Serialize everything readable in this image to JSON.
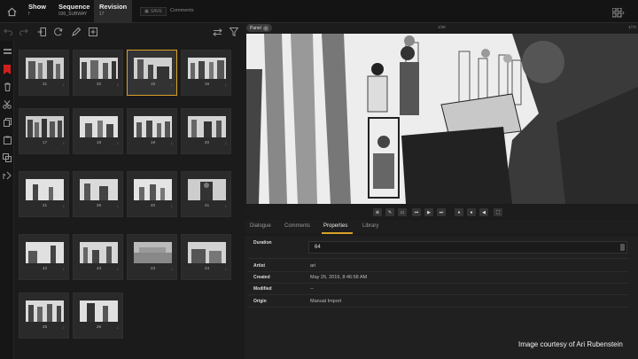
{
  "topbar": {
    "show_title": "Show",
    "show_value": "f",
    "sequence_title": "Sequence",
    "sequence_value": "030_SUBWAY",
    "revision_title": "Revision",
    "revision_value": "17",
    "save_label": "SAVE",
    "comments_label": "Comments"
  },
  "board": {
    "cards": [
      {
        "num": "31",
        "mark": "1"
      },
      {
        "num": "32",
        "mark": "2"
      },
      {
        "num": "15",
        "mark": "1"
      },
      {
        "num": "16",
        "mark": "1"
      },
      {
        "num": "17",
        "mark": "1"
      },
      {
        "num": "18",
        "mark": "1"
      },
      {
        "num": "19",
        "mark": "1"
      },
      {
        "num": "20",
        "mark": "1"
      },
      {
        "num": "21",
        "mark": "1"
      },
      {
        "num": "39",
        "mark": "1"
      },
      {
        "num": "40",
        "mark": "1"
      },
      {
        "num": "41",
        "mark": "1"
      },
      {
        "num": "42",
        "mark": "1"
      },
      {
        "num": "43",
        "mark": "1"
      },
      {
        "num": "23",
        "mark": "1"
      },
      {
        "num": "24",
        "mark": "1"
      },
      {
        "num": "25",
        "mark": "1"
      },
      {
        "num": "26",
        "mark": "1"
      }
    ]
  },
  "viewer": {
    "panel_label": "Panel",
    "frame_mid": "1/36",
    "frame_right": "1/72"
  },
  "tabs": {
    "dialogue": "Dialogue",
    "comments": "Comments",
    "properties": "Properties",
    "library": "Library"
  },
  "properties": {
    "duration_label": "Duration",
    "duration_value": "64",
    "artist_label": "Artist",
    "artist_value": "ari",
    "created_label": "Created",
    "created_value": "May 26, 2019, 8:46:58 AM",
    "modified_label": "Modified",
    "modified_value": "--",
    "origin_label": "Origin",
    "origin_value": "Manual Import"
  },
  "credit": "Image courtesy of Ari Rubenstein",
  "colors": {
    "accent": "#d8a12a",
    "background": "#1b1b1b"
  }
}
